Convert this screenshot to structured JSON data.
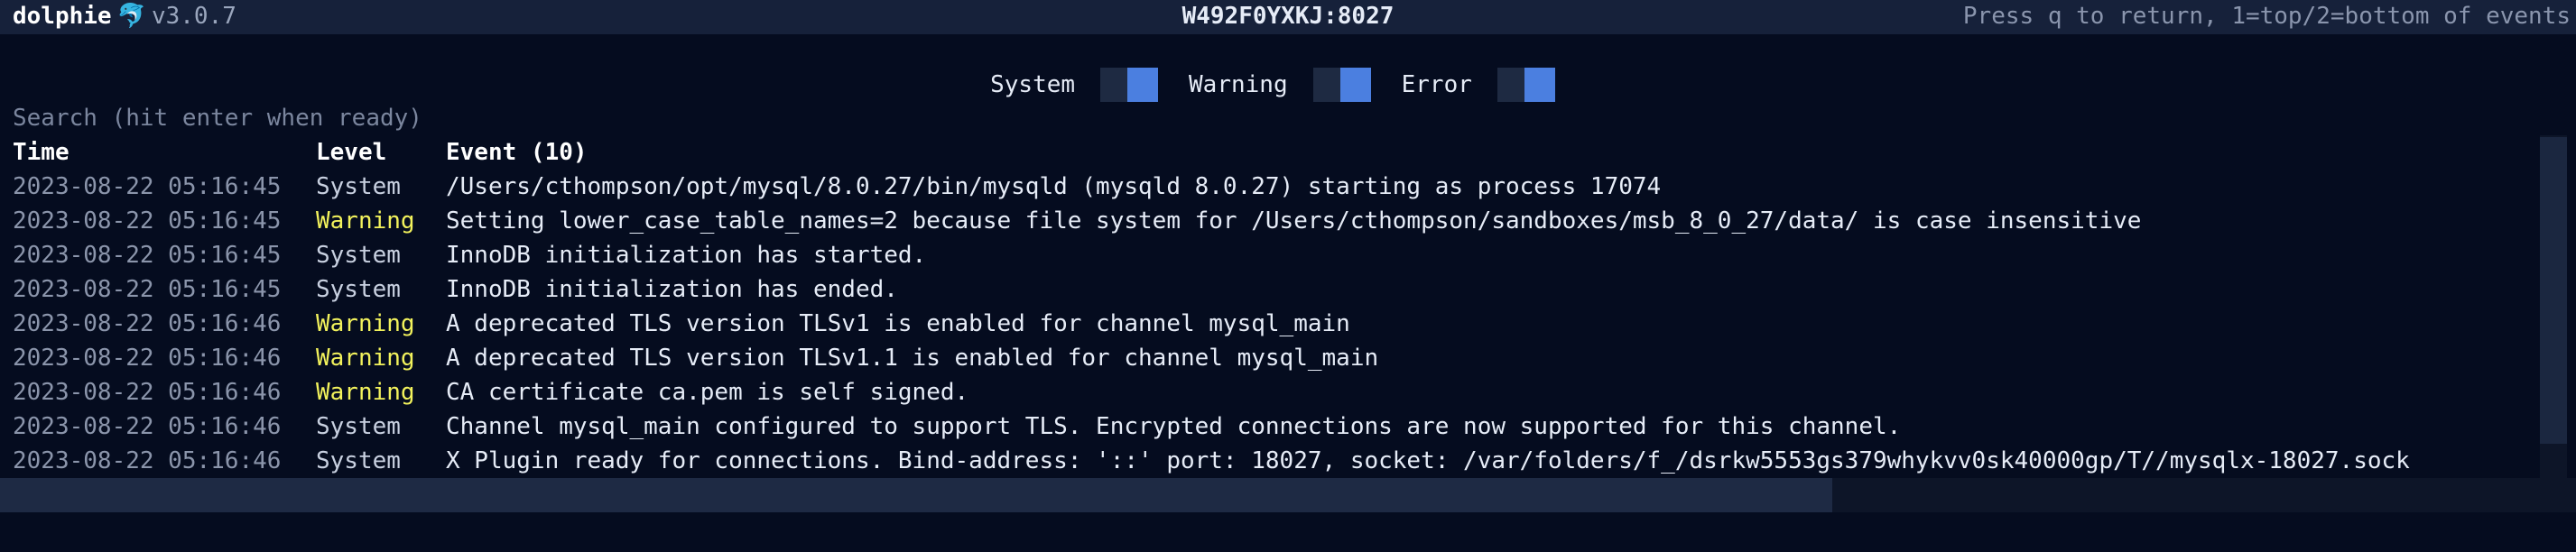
{
  "header": {
    "app_name": "dolphie",
    "logo_glyph": "🐬",
    "version": "v3.0.7",
    "host": "W492F0YXKJ:8027",
    "hint": "Press q to return, 1=top/2=bottom of events"
  },
  "filters": [
    {
      "label": "System",
      "enabled": true
    },
    {
      "label": "Warning",
      "enabled": true
    },
    {
      "label": "Error",
      "enabled": true
    }
  ],
  "search": {
    "placeholder": "Search (hit enter when ready)"
  },
  "table": {
    "columns": [
      "Time",
      "Level",
      "Event (10)"
    ],
    "rows": [
      {
        "time": "2023-08-22 05:16:45",
        "level": "System",
        "event": "/Users/cthompson/opt/mysql/8.0.27/bin/mysqld (mysqld 8.0.27) starting as process 17074"
      },
      {
        "time": "2023-08-22 05:16:45",
        "level": "Warning",
        "event": "Setting lower_case_table_names=2 because file system for /Users/cthompson/sandboxes/msb_8_0_27/data/ is case insensitive"
      },
      {
        "time": "2023-08-22 05:16:45",
        "level": "System",
        "event": "InnoDB initialization has started."
      },
      {
        "time": "2023-08-22 05:16:45",
        "level": "System",
        "event": "InnoDB initialization has ended."
      },
      {
        "time": "2023-08-22 05:16:46",
        "level": "Warning",
        "event": "A deprecated TLS version TLSv1 is enabled for channel mysql_main"
      },
      {
        "time": "2023-08-22 05:16:46",
        "level": "Warning",
        "event": "A deprecated TLS version TLSv1.1 is enabled for channel mysql_main"
      },
      {
        "time": "2023-08-22 05:16:46",
        "level": "Warning",
        "event": "CA certificate ca.pem is self signed."
      },
      {
        "time": "2023-08-22 05:16:46",
        "level": "System",
        "event": "Channel mysql_main configured to support TLS. Encrypted connections are now supported for this channel."
      },
      {
        "time": "2023-08-22 05:16:46",
        "level": "System",
        "event": "X Plugin ready for connections. Bind-address: '::' port: 18027, socket: /var/folders/f_/dsrkw5553gs379whykvv0sk40000gp/T//mysqlx-18027.sock"
      }
    ]
  },
  "colors": {
    "background": "#050c1f",
    "warning": "#f2f25c",
    "toggle_on": "#4b7fe0"
  }
}
